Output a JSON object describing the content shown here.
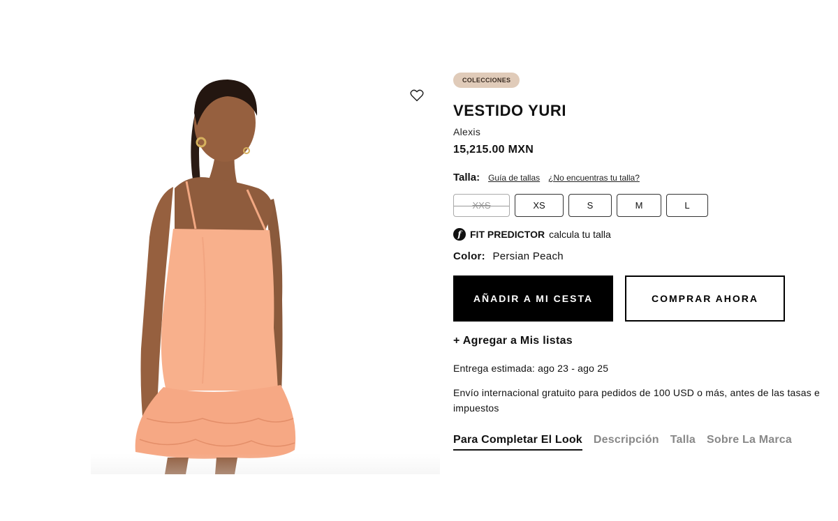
{
  "product": {
    "badge": "COLECCIONES",
    "title": "VESTIDO YURI",
    "brand": "Alexis",
    "price": "15,215.00 MXN"
  },
  "size": {
    "label": "Talla:",
    "guide_link": "Guía de tallas",
    "missing_link": "¿No encuentras tu talla?",
    "options": [
      {
        "label": "XXS",
        "available": false
      },
      {
        "label": "XS",
        "available": true
      },
      {
        "label": "S",
        "available": true
      },
      {
        "label": "M",
        "available": true
      },
      {
        "label": "L",
        "available": true
      }
    ]
  },
  "fit_predictor": {
    "logo_letter": "f",
    "name": "FIT PREDICTOR",
    "text": "calcula tu talla"
  },
  "color": {
    "label": "Color:",
    "value": "Persian Peach"
  },
  "actions": {
    "add_to_bag": "AÑADIR A MI CESTA",
    "buy_now": "COMPRAR AHORA",
    "add_to_lists": "+ Agregar a Mis listas"
  },
  "delivery": "Entrega estimada: ago 23 - ago 25",
  "shipping": "Envío internacional gratuito para pedidos de 100 USD o más, antes de las tasas e impuestos",
  "tabs": [
    {
      "label": "Para Completar El Look",
      "active": true
    },
    {
      "label": "Descripción",
      "active": false
    },
    {
      "label": "Talla",
      "active": false
    },
    {
      "label": "Sobre La Marca",
      "active": false
    }
  ],
  "colors": {
    "badge_bg": "#e0cbb9",
    "dress": "#f8b08c",
    "primary_button": "#000000"
  },
  "icons": {
    "favorite": "heart-outline-icon"
  }
}
